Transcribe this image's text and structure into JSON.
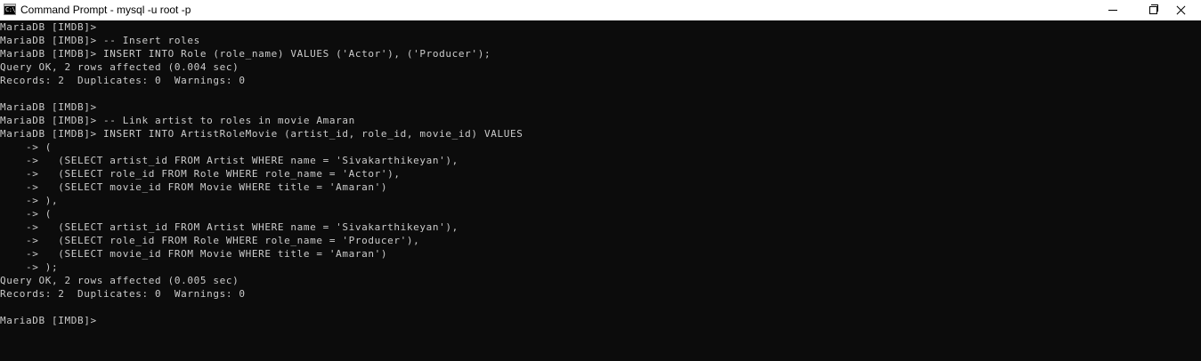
{
  "window": {
    "title": "Command Prompt - mysql  -u root -p",
    "icon": "cmd-app-icon",
    "icon_glyph": "C:\\"
  },
  "controls": {
    "minimize_icon": "minimize-icon",
    "restore_icon": "restore-icon",
    "close_icon": "close-icon"
  },
  "colors": {
    "background": "#0c0c0c",
    "foreground": "#cccccc",
    "titlebar": "#ffffff"
  },
  "console": {
    "lines": [
      "MariaDB [IMDB]>",
      "MariaDB [IMDB]> -- Insert roles",
      "MariaDB [IMDB]> INSERT INTO Role (role_name) VALUES ('Actor'), ('Producer');",
      "Query OK, 2 rows affected (0.004 sec)",
      "Records: 2  Duplicates: 0  Warnings: 0",
      "",
      "MariaDB [IMDB]>",
      "MariaDB [IMDB]> -- Link artist to roles in movie Amaran",
      "MariaDB [IMDB]> INSERT INTO ArtistRoleMovie (artist_id, role_id, movie_id) VALUES",
      "    -> (",
      "    ->   (SELECT artist_id FROM Artist WHERE name = 'Sivakarthikeyan'),",
      "    ->   (SELECT role_id FROM Role WHERE role_name = 'Actor'),",
      "    ->   (SELECT movie_id FROM Movie WHERE title = 'Amaran')",
      "    -> ),",
      "    -> (",
      "    ->   (SELECT artist_id FROM Artist WHERE name = 'Sivakarthikeyan'),",
      "    ->   (SELECT role_id FROM Role WHERE role_name = 'Producer'),",
      "    ->   (SELECT movie_id FROM Movie WHERE title = 'Amaran')",
      "    -> );",
      "Query OK, 2 rows affected (0.005 sec)",
      "Records: 2  Duplicates: 0  Warnings: 0",
      "",
      "MariaDB [IMDB]>"
    ]
  }
}
